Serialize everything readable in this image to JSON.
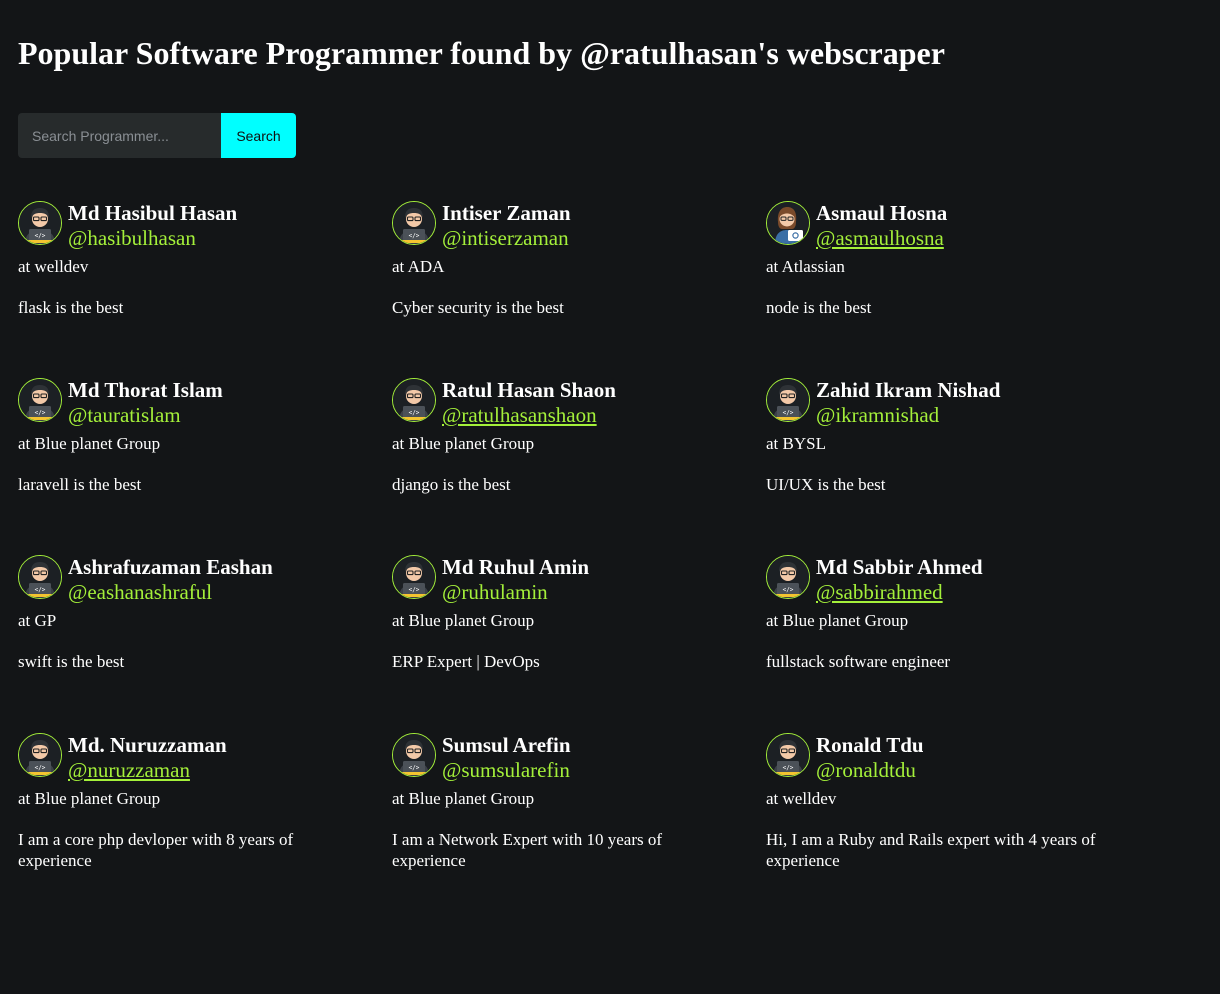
{
  "header": {
    "title": "Popular Software Programmer found by @ratulhasan's webscraper"
  },
  "search": {
    "placeholder": "Search Programmer...",
    "value": "",
    "button_label": "Search"
  },
  "colors": {
    "background": "#131517",
    "accent": "#a4f03a",
    "button": "#00ffff",
    "input_bg": "#272b2c"
  },
  "programmers": [
    {
      "name": "Md Hasibul Hasan",
      "handle": "@hasibulhasan",
      "company": "at welldev",
      "bio": "flask is the best",
      "avatar_icon": "programmer-avatar-icon",
      "underlined": false
    },
    {
      "name": "Intiser Zaman",
      "handle": "@intiserzaman",
      "company": "at ADA",
      "bio": "Cyber security is the best",
      "avatar_icon": "programmer-avatar-icon",
      "underlined": false
    },
    {
      "name": "Asmaul Hosna",
      "handle": "@asmaulhosna",
      "company": "at Atlassian",
      "bio": "node is the best",
      "avatar_icon": "female-programmer-avatar-icon",
      "underlined": true
    },
    {
      "name": "Md Thorat Islam",
      "handle": "@tauratislam",
      "company": "at Blue planet Group",
      "bio": "laravell is the best",
      "avatar_icon": "programmer-avatar-icon",
      "underlined": false
    },
    {
      "name": "Ratul Hasan Shaon",
      "handle": "@ratulhasanshaon",
      "company": "at Blue planet Group",
      "bio": "django is the best",
      "avatar_icon": "programmer-avatar-icon",
      "underlined": true
    },
    {
      "name": "Zahid Ikram Nishad",
      "handle": "@ikramnishad",
      "company": "at BYSL",
      "bio": "UI/UX is the best",
      "avatar_icon": "programmer-avatar-icon",
      "underlined": false
    },
    {
      "name": "Ashrafuzaman Eashan",
      "handle": "@eashanashraful",
      "company": "at GP",
      "bio": "swift is the best",
      "avatar_icon": "programmer-avatar-icon",
      "underlined": false
    },
    {
      "name": "Md Ruhul Amin",
      "handle": "@ruhulamin",
      "company": "at Blue planet Group",
      "bio": "ERP Expert | DevOps",
      "avatar_icon": "programmer-avatar-icon",
      "underlined": false
    },
    {
      "name": "Md Sabbir Ahmed",
      "handle": "@sabbirahmed",
      "company": "at Blue planet Group",
      "bio": "fullstack software engineer",
      "avatar_icon": "programmer-avatar-icon",
      "underlined": true
    },
    {
      "name": "Md. Nuruzzaman",
      "handle": "@nuruzzaman",
      "company": "at Blue planet Group",
      "bio": "I am a core php devloper with 8 years of experience",
      "avatar_icon": "programmer-avatar-icon",
      "underlined": true
    },
    {
      "name": "Sumsul Arefin",
      "handle": "@sumsularefin",
      "company": "at Blue planet Group",
      "bio": "I am a Network Expert with 10 years of experience",
      "avatar_icon": "programmer-avatar-icon",
      "underlined": false
    },
    {
      "name": "Ronald Tdu",
      "handle": "@ronaldtdu",
      "company": "at welldev",
      "bio": "Hi, I am a Ruby and Rails expert with 4 years of experience",
      "avatar_icon": "programmer-avatar-icon",
      "underlined": false
    }
  ]
}
